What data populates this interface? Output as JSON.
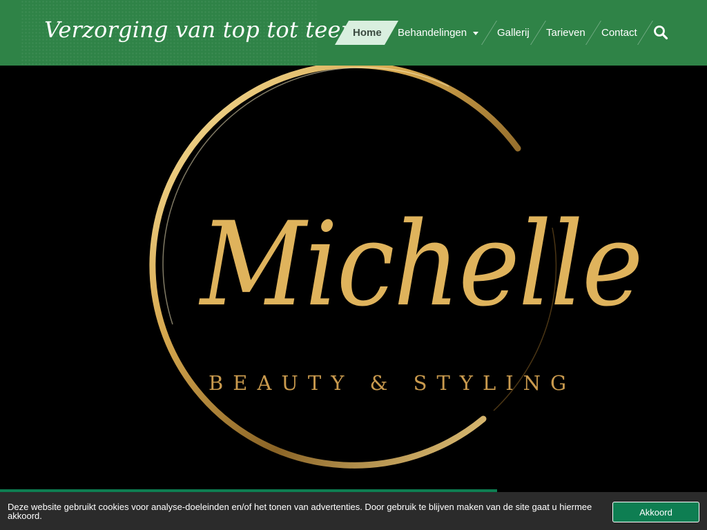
{
  "header": {
    "tagline": "Verzorging van top tot teen",
    "bg_color": "#2f8347"
  },
  "nav": {
    "items": [
      {
        "label": "Home",
        "active": true
      },
      {
        "label": "Behandelingen",
        "has_dropdown": true
      },
      {
        "label": "Gallerij"
      },
      {
        "label": "Tarieven"
      },
      {
        "label": "Contact"
      }
    ],
    "search_icon": "search-icon"
  },
  "hero": {
    "logo_script": "Michelle",
    "logo_subtitle": "BEAUTY & STYLING",
    "logo_color": "#dfb35c"
  },
  "cookie_bar": {
    "text": "Deze website gebruikt cookies voor analyse-doeleinden en/of het tonen van advertenties. Door gebruik te blijven maken van de site gaat u hiermee akkoord.",
    "button_label": "Akkoord",
    "accent_color": "#0e7e52"
  }
}
